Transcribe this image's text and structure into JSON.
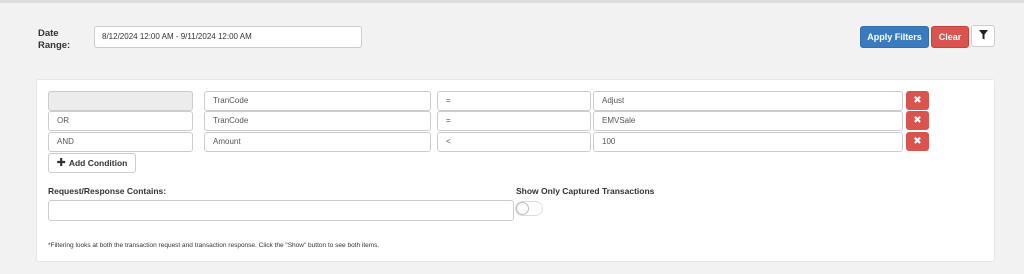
{
  "date_range": {
    "label": "Date Range:",
    "value": "8/12/2024 12:00 AM - 9/11/2024 12:00 AM"
  },
  "toolbar": {
    "apply_label": "Apply Filters",
    "clear_label": "Clear",
    "filter_icon": "filter-icon"
  },
  "conditions": [
    {
      "logic": "",
      "field": "TranCode",
      "operator": "=",
      "value": "Adjust"
    },
    {
      "logic": "OR",
      "field": "TranCode",
      "operator": "=",
      "value": "EMVSale"
    },
    {
      "logic": "AND",
      "field": "Amount",
      "operator": "<",
      "value": "100"
    }
  ],
  "add_condition": {
    "label": "Add Condition"
  },
  "request_response": {
    "label": "Request/Response Contains:",
    "value": ""
  },
  "captured": {
    "label": "Show Only Captured Transactions",
    "enabled": false
  },
  "note": "*Filtering looks at both the transaction request and transaction response. Click the \"Show\" button to see both items.",
  "colors": {
    "primary": "#3a7bbf",
    "danger": "#d9534f"
  }
}
